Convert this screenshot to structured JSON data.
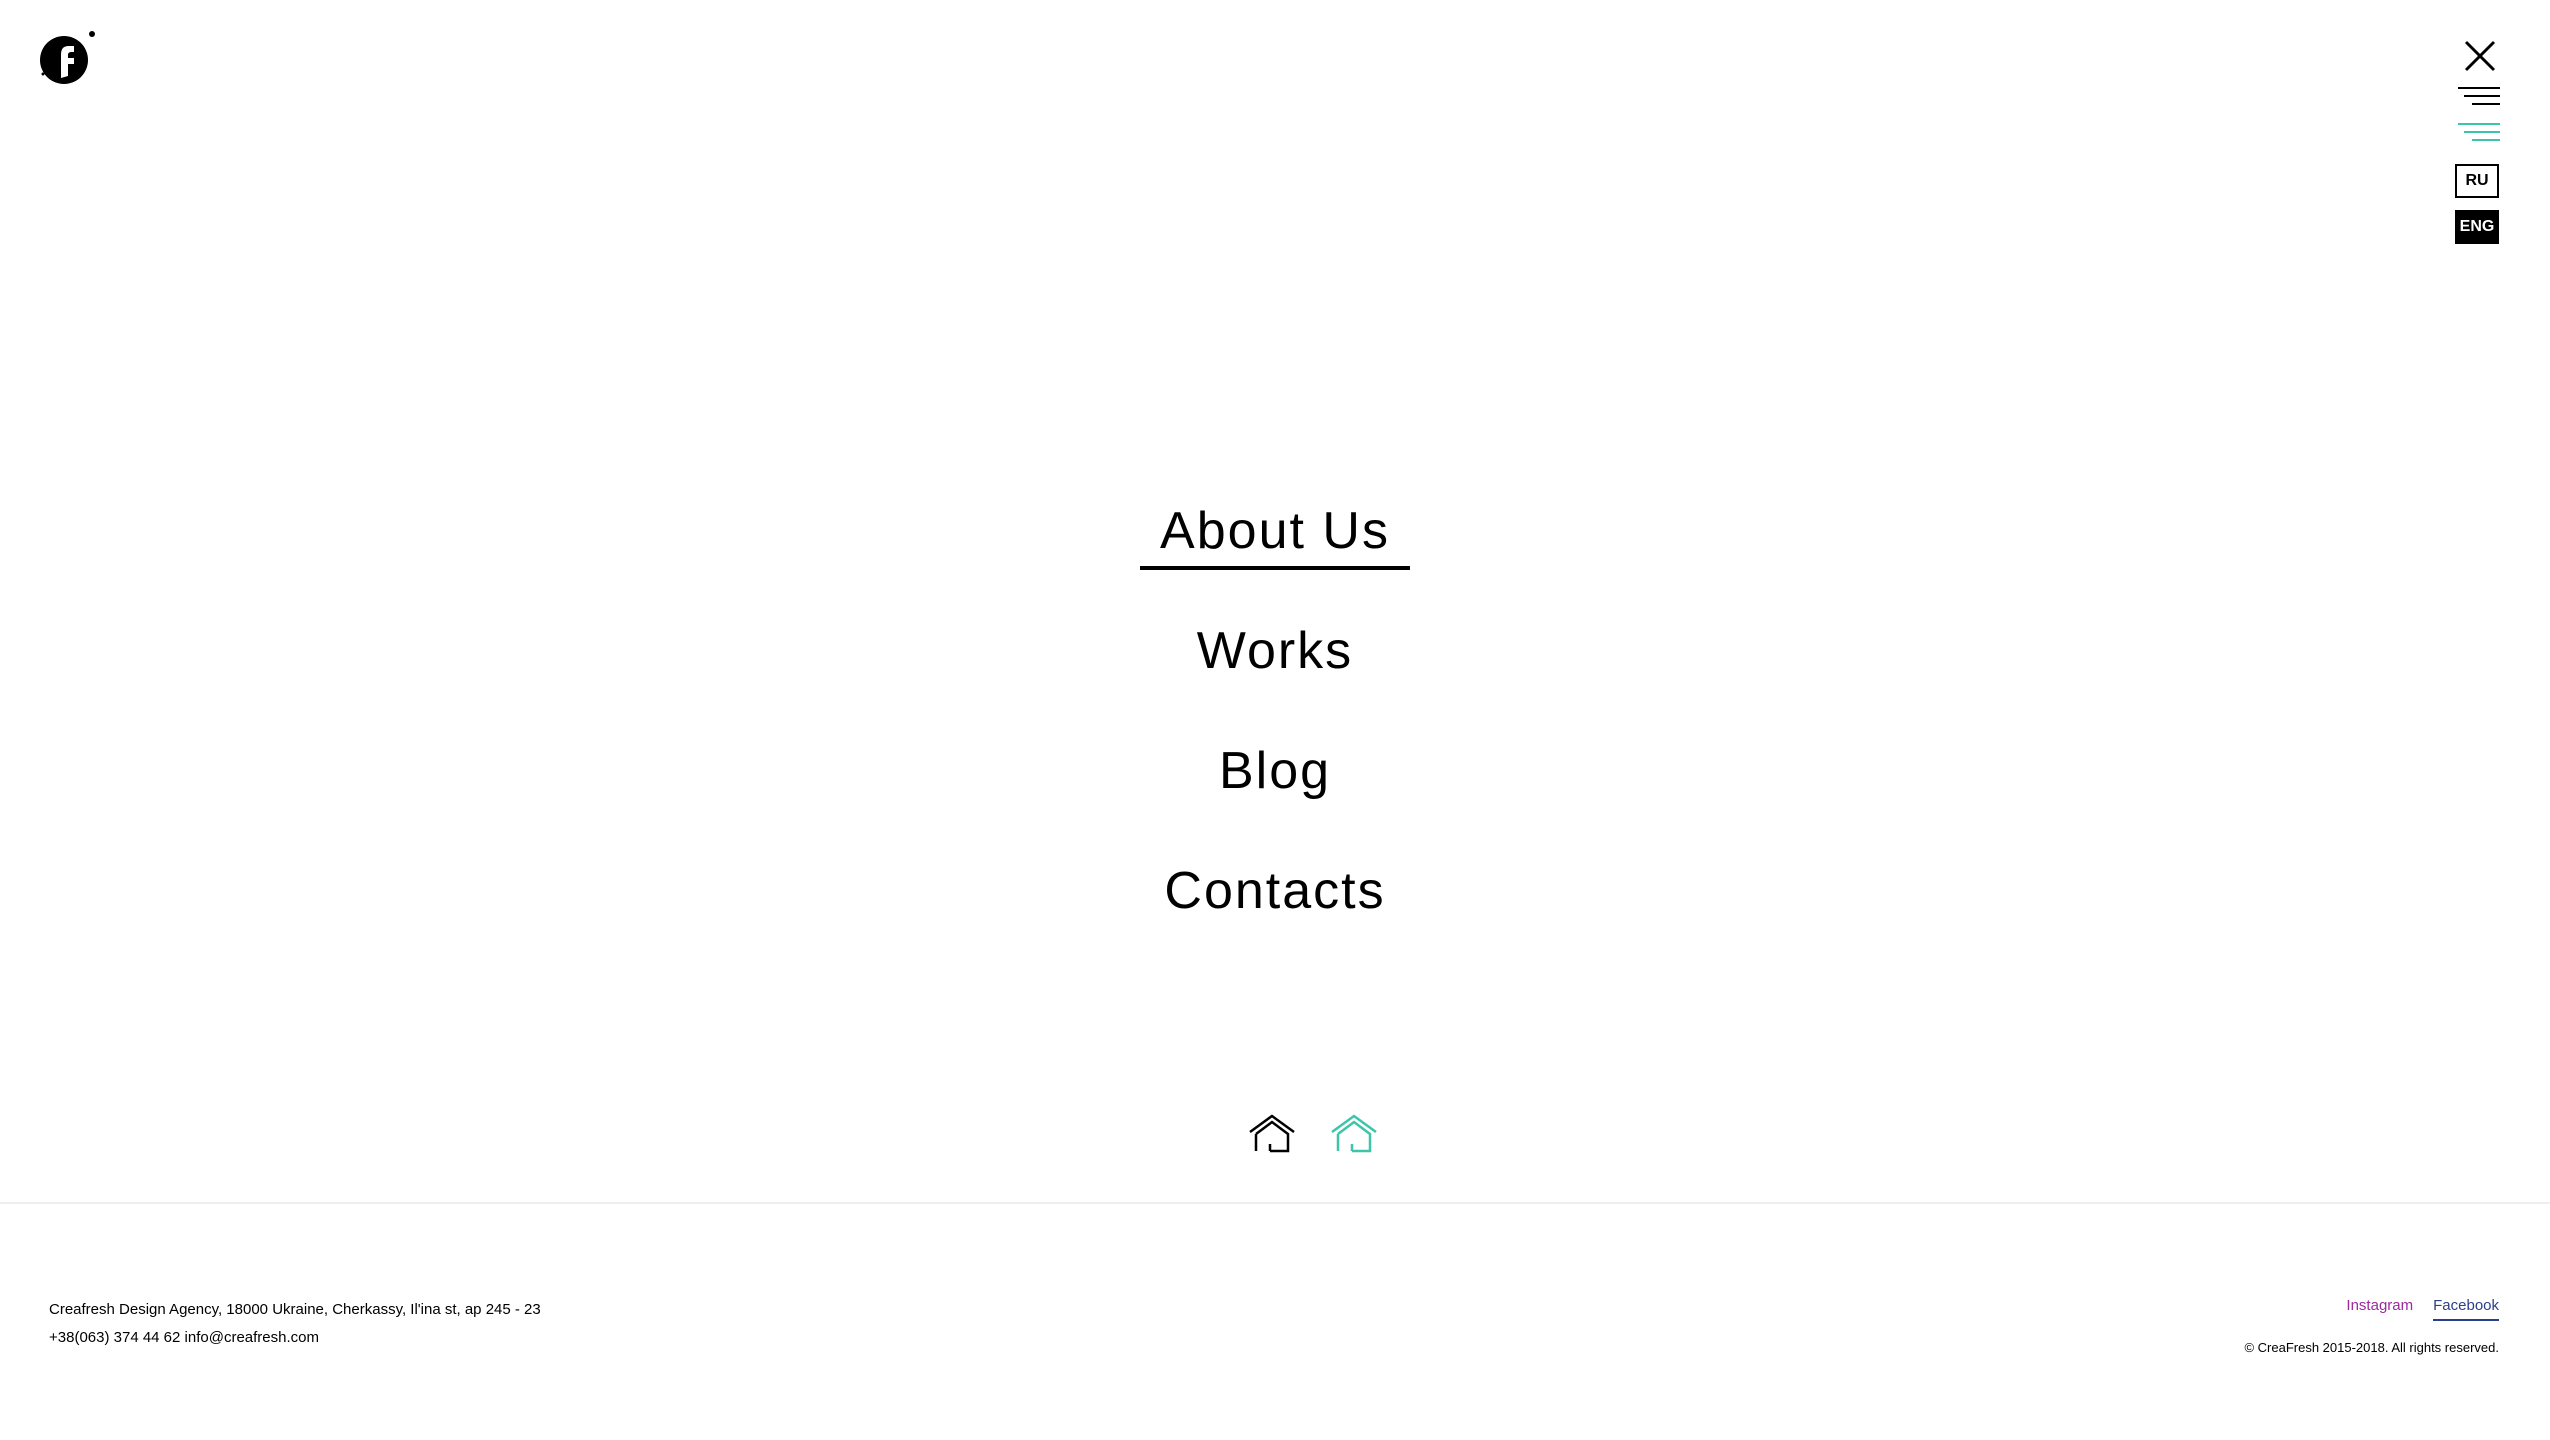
{
  "header": {
    "logo_icon": "creafresh-logo",
    "close_icon": "close-icon",
    "menu_icon": "menu-lines-icon",
    "menu_accent_icon": "menu-lines-accent-icon",
    "lang_ru": "RU",
    "lang_eng": "ENG",
    "lang_selected": "ENG"
  },
  "nav": {
    "items": [
      {
        "label": "About Us",
        "active": true
      },
      {
        "label": "Works"
      },
      {
        "label": "Blog"
      },
      {
        "label": "Contacts"
      }
    ]
  },
  "home_icons": [
    "home-icon",
    "home-icon-accent"
  ],
  "footer": {
    "address": "Creafresh Design Agency, 18000 Ukraine, Cherkassy, Il'ina st, ap 245 - 23",
    "phone": "+38(063) 374 44 62",
    "email": "info@creafresh.com",
    "instagram": "Instagram",
    "facebook": "Facebook",
    "copyright": "© CreaFresh 2015-2018. All rights reserved."
  },
  "colors": {
    "accent": "#3cc5a8",
    "instagram": "#9b2a9d",
    "facebook": "#2c3f8c",
    "text": "#000000"
  }
}
